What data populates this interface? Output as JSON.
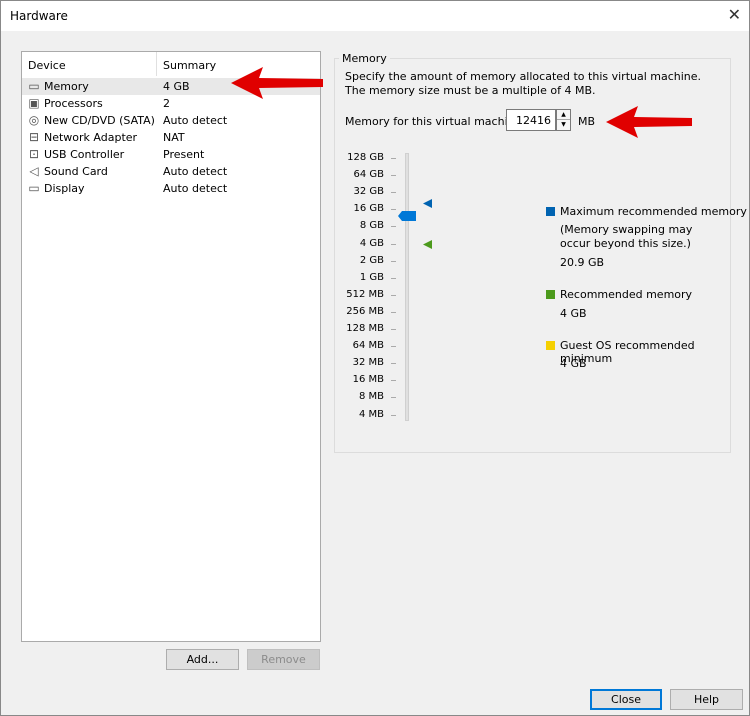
{
  "window": {
    "title": "Hardware"
  },
  "devices": {
    "headers": {
      "device": "Device",
      "summary": "Summary"
    },
    "items": [
      {
        "name": "Memory",
        "summary": "4 GB",
        "icon": "memory-icon",
        "glyph": "▭",
        "selected": true
      },
      {
        "name": "Processors",
        "summary": "2",
        "icon": "processor-icon",
        "glyph": "▣"
      },
      {
        "name": "New CD/DVD (SATA)",
        "summary": "Auto detect",
        "icon": "cd-dvd-icon",
        "glyph": "◎"
      },
      {
        "name": "Network Adapter",
        "summary": "NAT",
        "icon": "network-adapter-icon",
        "glyph": "⊟"
      },
      {
        "name": "USB Controller",
        "summary": "Present",
        "icon": "usb-icon",
        "glyph": "⊡"
      },
      {
        "name": "Sound Card",
        "summary": "Auto detect",
        "icon": "speaker-icon",
        "glyph": "◁"
      },
      {
        "name": "Display",
        "summary": "Auto detect",
        "icon": "monitor-icon",
        "glyph": "▭"
      }
    ],
    "add_label": "Add...",
    "remove_label": "Remove"
  },
  "memory": {
    "group_label": "Memory",
    "description": "Specify the amount of memory allocated to this virtual machine. The memory size must be a multiple of 4 MB.",
    "field_label": "Memory for this virtual machine:",
    "value": "12416",
    "value_mb": 12416,
    "unit": "MB",
    "scale": [
      "128 GB",
      "64 GB",
      "32 GB",
      "16 GB",
      "8 GB",
      "4 GB",
      "2 GB",
      "1 GB",
      "512 MB",
      "256 MB",
      "128 MB",
      "64 MB",
      "32 MB",
      "16 MB",
      "8 MB",
      "4 MB"
    ],
    "max_recommended_mb": 21402,
    "recommended_mb": 4096,
    "legend": {
      "max_label": "Maximum recommended memory",
      "max_note": "(Memory swapping may occur beyond this size.)",
      "max_value": "20.9 GB",
      "rec_label": "Recommended memory",
      "rec_value": "4 GB",
      "min_label": "Guest OS recommended minimum",
      "min_value": "4 GB"
    },
    "colors": {
      "max": "#0063b1",
      "rec": "#4c9a1c",
      "min": "#f5d000",
      "thumb": "#0078d7"
    }
  },
  "footer": {
    "close_label": "Close",
    "help_label": "Help"
  },
  "annotations": {
    "arrow_color": "#e00000"
  }
}
